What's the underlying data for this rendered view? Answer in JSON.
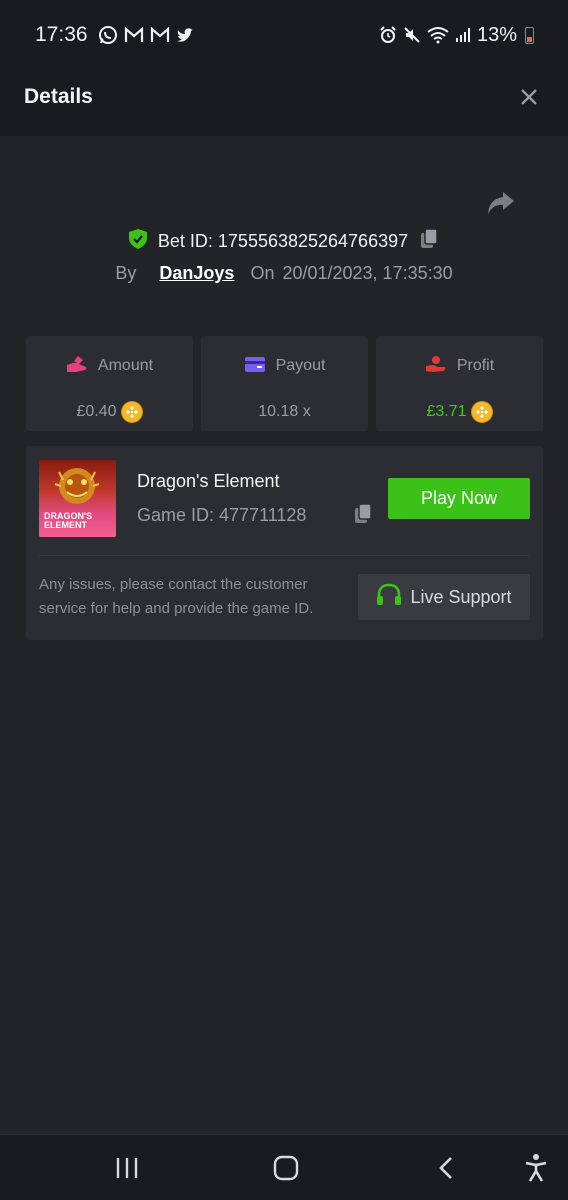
{
  "status_bar": {
    "time": "17:36",
    "battery": "13%",
    "left_icons": [
      "whatsapp-icon",
      "gmail-icon",
      "gmail-icon",
      "twitter-icon"
    ],
    "right_icons": [
      "alarm-icon",
      "mute-icon",
      "wifi-icon",
      "signal-icon",
      "battery-icon"
    ]
  },
  "header": {
    "title": "Details",
    "close_icon": "close-icon"
  },
  "bet": {
    "label": "Bet ID:",
    "id": "1755563825264766397",
    "by_label": "By",
    "user": "DanJoys",
    "on_label": "On",
    "datetime": "20/01/2023, 17:35:30"
  },
  "stats": {
    "amount": {
      "label": "Amount",
      "value": "£0.40",
      "icon": "hand-coin-icon",
      "icon_color": "#e5417a"
    },
    "payout": {
      "label": "Payout",
      "value": "10.18 x",
      "icon": "card-icon",
      "icon_color": "#7b5cf0"
    },
    "profit": {
      "label": "Profit",
      "value": "£3.71",
      "icon": "hand-heart-icon",
      "icon_color": "#e53935",
      "value_color": "#3ccb1e"
    }
  },
  "game": {
    "name": "Dragon's Element",
    "id_label": "Game ID: 477711128",
    "thumb_title_line1": "DRAGON'S",
    "thumb_title_line2": "ELEMENT",
    "play_label": "Play Now",
    "issues_text": "Any issues, please contact the customer service for help and provide the game ID.",
    "support_label": "Live Support"
  },
  "colors": {
    "accent_green": "#3bc117",
    "background": "#232428",
    "panel": "#2c2d32"
  }
}
